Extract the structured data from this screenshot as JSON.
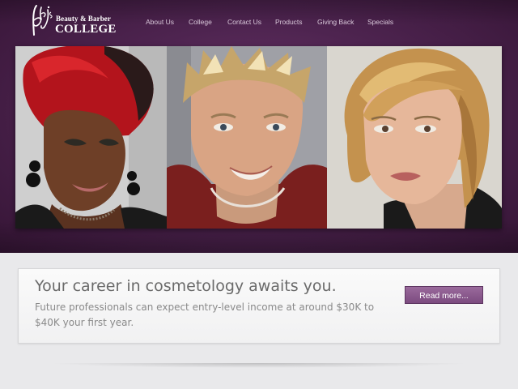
{
  "logo": {
    "monogram": "bbjs",
    "line1": "Beauty & Barber",
    "line2": "COLLEGE"
  },
  "nav": {
    "items": [
      {
        "label": "About Us"
      },
      {
        "label": "College"
      },
      {
        "label": "Contact Us"
      },
      {
        "label": "Products"
      },
      {
        "label": "Giving Back"
      },
      {
        "label": "Specials"
      }
    ]
  },
  "photos": [
    {
      "name": "woman-red-hair-photo"
    },
    {
      "name": "man-spiky-blond-hair-photo"
    },
    {
      "name": "woman-blonde-bob-photo"
    }
  ],
  "promo": {
    "title": "Your career in cosmetology awaits you.",
    "body": "Future professionals can expect entry-level income at around $30K to $40K your first year.",
    "button_label": "Read more..."
  },
  "colors": {
    "header_purple": "#4e2450",
    "button_purple": "#8a5a8e",
    "page_background": "#e9e9eb"
  }
}
